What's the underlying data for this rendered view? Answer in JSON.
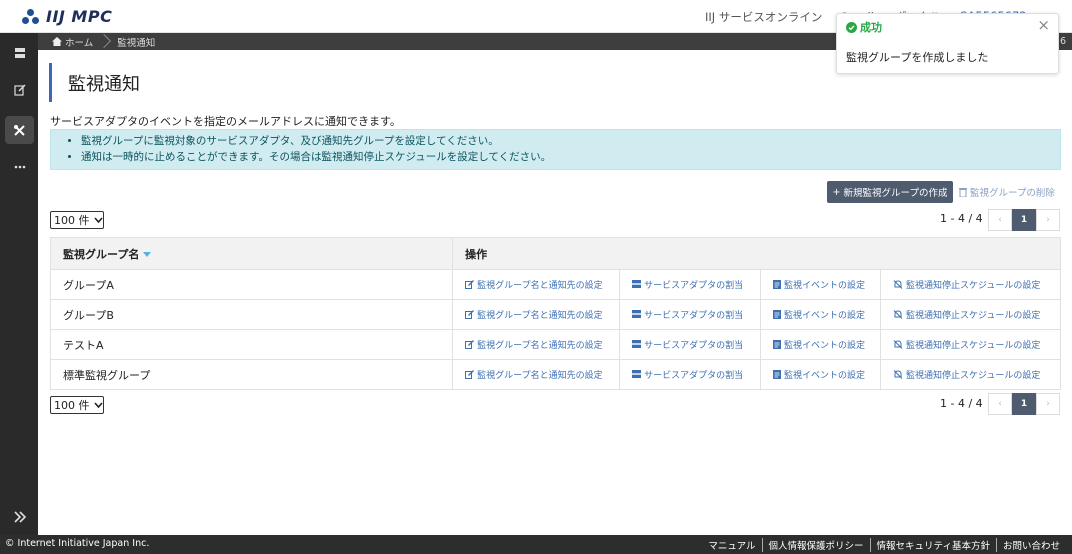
{
  "app": {
    "logo_text": "IIJ MPC"
  },
  "topnav": {
    "service_online": "IIJ サービスオンライン",
    "portal": "Omnibus ポータル",
    "user": "SA5565672"
  },
  "breadcrumb": {
    "home": "ホーム",
    "current": "監視通知",
    "right_text": "6"
  },
  "page": {
    "title": "監視通知",
    "description": "サービスアダプタのイベントを指定のメールアドレスに通知できます。",
    "info": [
      "監視グループに監視対象のサービスアダプタ、及び通知先グループを設定してください。",
      "通知は一時的に止めることができます。その場合は監視通知停止スケジュールを設定してください。"
    ]
  },
  "actions": {
    "new_group": "新規監視グループの作成",
    "delete_group": "監視グループの削除"
  },
  "pagination": {
    "per_page": "100 件",
    "range": "1 - 4 / 4",
    "prev": "‹",
    "current": "1",
    "next": "›"
  },
  "table": {
    "headers": {
      "name": "監視グループ名",
      "operations": "操作"
    },
    "operations": {
      "name_notify": "監視グループ名と通知先の設定",
      "adapter": "サービスアダプタの割当",
      "event": "監視イベントの設定",
      "schedule": "監視通知停止スケジュールの設定"
    },
    "rows": [
      {
        "name": "グループA"
      },
      {
        "name": "グループB"
      },
      {
        "name": "テストA"
      },
      {
        "name": "標準監視グループ"
      }
    ]
  },
  "toast": {
    "title": "成功",
    "message": "監視グループを作成しました",
    "close": "×"
  },
  "footer": {
    "copyright": "© Internet Initiative Japan Inc.",
    "links": [
      "マニュアル",
      "個人情報保護ポリシー",
      "情報セキュリティ基本方針",
      "お問い合わせ"
    ]
  },
  "colors": {
    "accent": "#3a6ab5",
    "button": "#4f5b6e",
    "info_bg": "#d1ecf1",
    "success": "#28a745",
    "link": "#3d6fb3"
  }
}
